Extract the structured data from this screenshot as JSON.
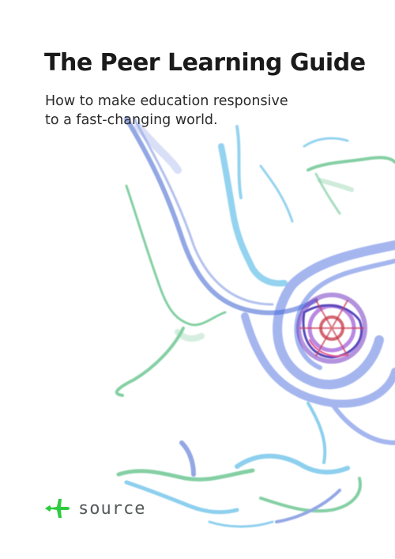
{
  "cover": {
    "title": "The Peer Learning Guide",
    "subtitle_line1": "How to make education responsive",
    "subtitle_line2": "to a fast-changing world."
  },
  "logo": {
    "wordmark": "source",
    "icon": "plane-icon",
    "color": "#2ecc40"
  },
  "colors": {
    "blue": "#3a5fd0",
    "cyan": "#2fa8e0",
    "green": "#1fa85a",
    "purple": "#6a2bbf",
    "red": "#c0182e"
  }
}
